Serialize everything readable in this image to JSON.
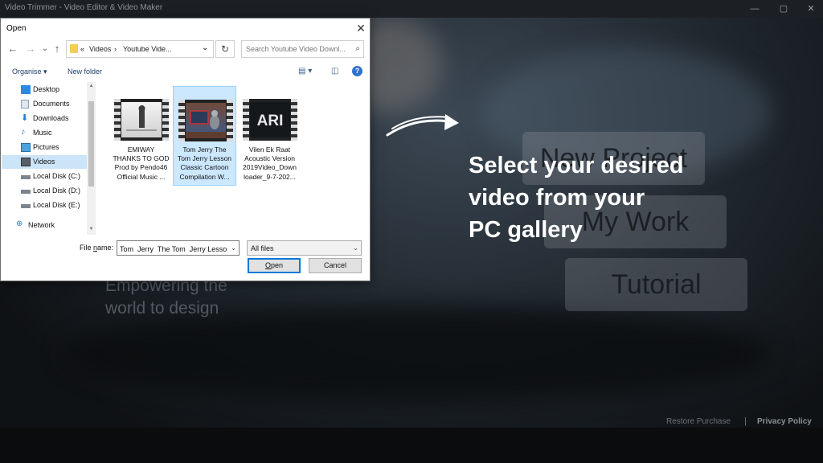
{
  "app": {
    "title": "Video Trimmer - Video Editor & Video Maker",
    "minimize": "—",
    "maximize": "▢",
    "close": "✕",
    "menu": [
      "New Project",
      "My Work",
      "Tutorial"
    ],
    "tagline_line1": "Empowering the",
    "tagline_line2": "world to design",
    "restore_purchase": "Restore Purchase",
    "separator": "|",
    "privacy_policy": "Privacy Policy"
  },
  "promo": {
    "line1": "Select your desired",
    "line2": "video from your",
    "line3": "PC gallery"
  },
  "dialog": {
    "title": "Open",
    "close": "✕",
    "nav": {
      "back": "←",
      "forward": "→",
      "dropdown": "⌄",
      "up": "↑"
    },
    "breadcrumb": [
      "«",
      "Videos",
      "›",
      "Youtube Vide...",
      "⌄"
    ],
    "refresh": "↻",
    "search_placeholder": "Search Youtube Video Downl...",
    "search_icon": "⌕",
    "toolbar": {
      "organise": "Organise ▾",
      "new_folder": "New folder",
      "view_icon": "▤ ▾",
      "pane_icon": "◫",
      "help": "?"
    },
    "tree": [
      "Desktop",
      "Documents",
      "Downloads",
      "Music",
      "Pictures",
      "Videos",
      "Local Disk (C:)",
      "Local Disk (D:)",
      "Local Disk (E:)",
      "Network"
    ],
    "selected_tree_item": "Videos",
    "files": [
      {
        "name_l1": "EMIWAY",
        "name_l2": "THANKS TO GOD",
        "name_l3": "Prod by Pendo46",
        "name_l4": "Official Music ..."
      },
      {
        "name_l1": "Tom  Jerry  The",
        "name_l2": "Tom  Jerry Lesson",
        "name_l3": "Classic Cartoon",
        "name_l4": "Compilation  W..."
      },
      {
        "name_l1": "Vilen  Ek Raat",
        "name_l2": "Acoustic Version",
        "name_l3": "2019Video_Down",
        "name_l4": "loader_9-7-202..."
      }
    ],
    "thumb3_text": "ARI",
    "file_name_label_pre": "File ",
    "file_name_label_u": "n",
    "file_name_label_post": "ame:",
    "file_name_value": "Tom  Jerry  The Tom  Jerry Lesson",
    "file_type": "All files",
    "dropdown_arrow": "⌄",
    "open_pre": "",
    "open_u": "O",
    "open_post": "pen",
    "cancel": "Cancel"
  },
  "colors": {
    "selection": "#cce8ff",
    "accent": "#0078d7",
    "folder": "#f3cd59"
  }
}
